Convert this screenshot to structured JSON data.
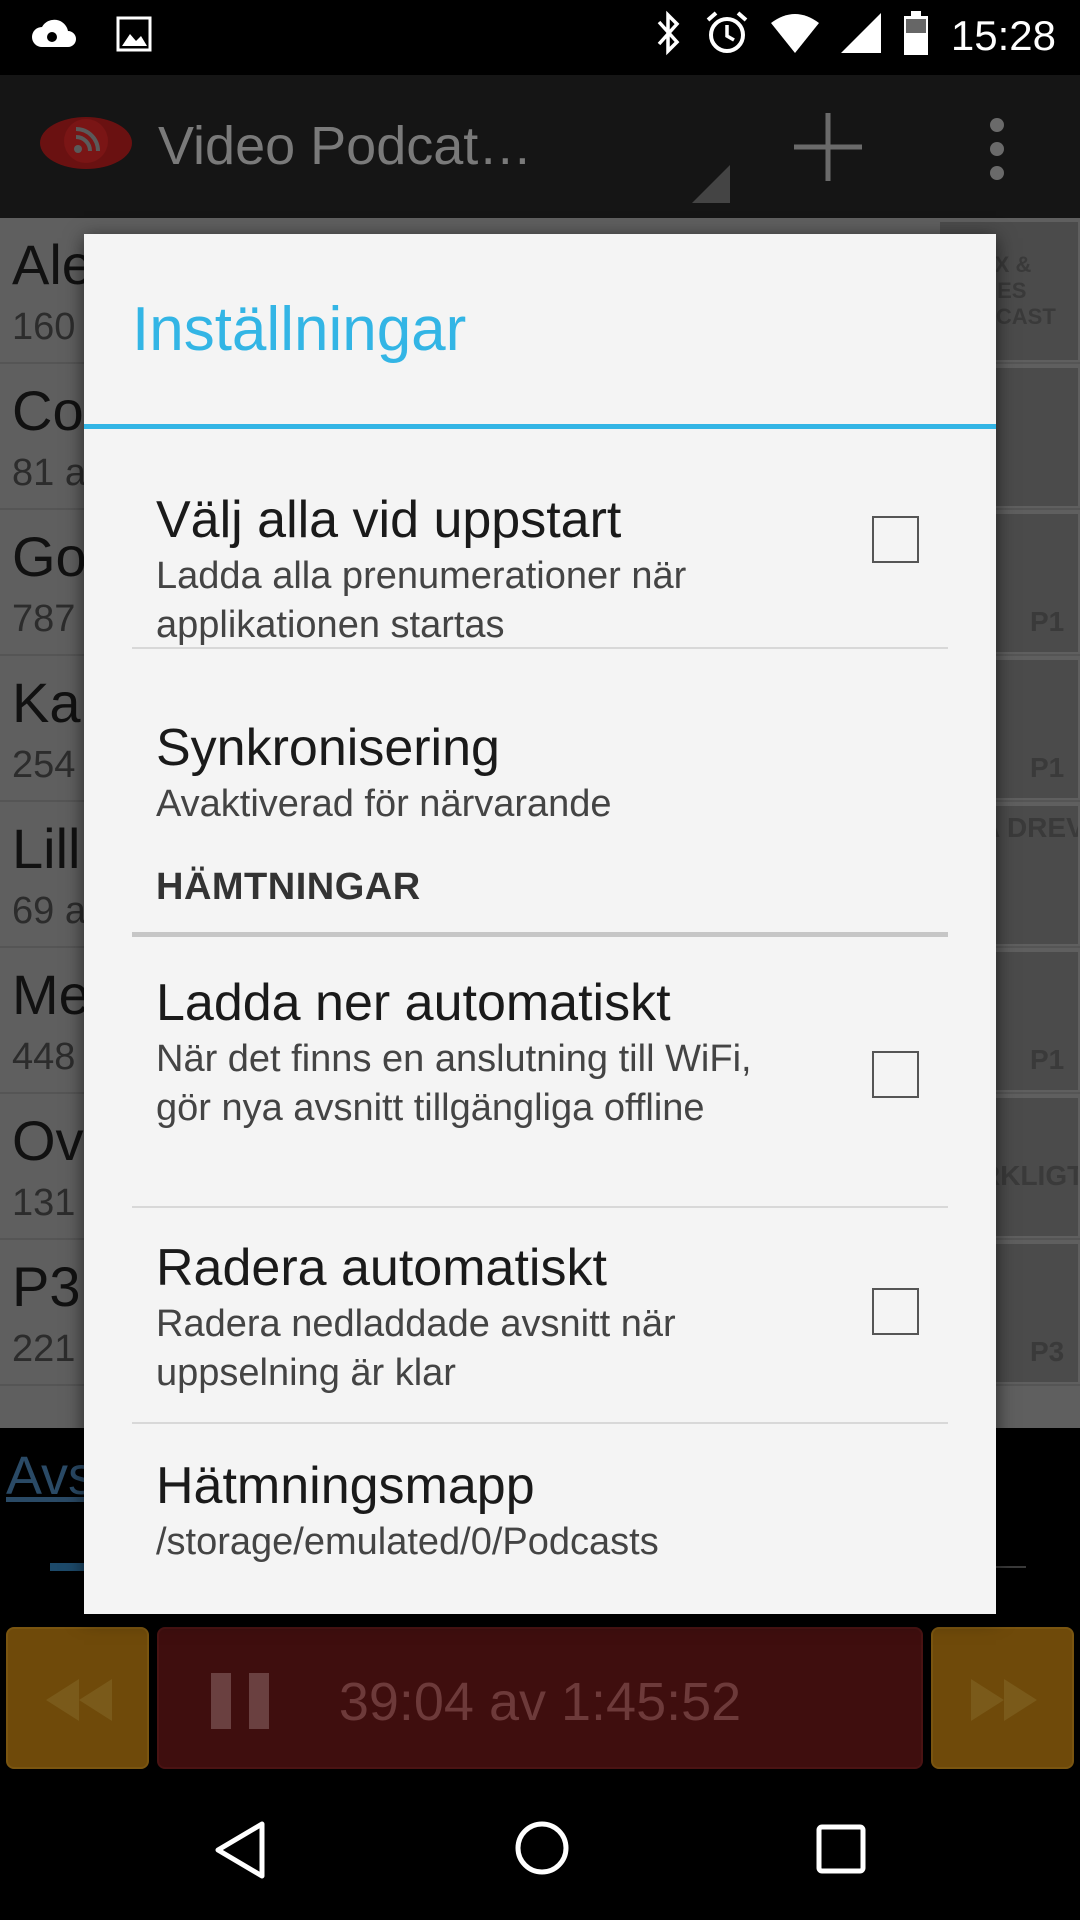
{
  "status_bar": {
    "time": "15:28",
    "left_icons": [
      "cloud-sync-icon",
      "image-icon"
    ],
    "right_icons": [
      "bluetooth-icon",
      "alarm-icon",
      "wifi-icon",
      "signal-icon",
      "battery-icon"
    ]
  },
  "app_bar": {
    "title": "Video Podcat…",
    "icons": [
      "app-logo-icon",
      "add-icon",
      "overflow-menu-icon"
    ]
  },
  "background_list": {
    "rows": [
      {
        "title": "Ale",
        "subtitle": "160"
      },
      {
        "title": "Co",
        "subtitle": "81 a"
      },
      {
        "title": "Go",
        "subtitle": "787"
      },
      {
        "title": "Ka",
        "subtitle": "254"
      },
      {
        "title": "Lill",
        "subtitle": "69 a"
      },
      {
        "title": "Me",
        "subtitle": "448"
      },
      {
        "title": "Ov",
        "subtitle": "131"
      },
      {
        "title": "P3",
        "subtitle": "221"
      }
    ],
    "thumb_labels": [
      "EX & GES DCAST",
      "",
      "P1",
      "P1",
      "A DREVET",
      "P1",
      "RKLIGT",
      "P3"
    ],
    "link_text": "Avs"
  },
  "player": {
    "time_text": "39:04 av 1:45:52",
    "icons": [
      "rewind-icon",
      "pause-icon",
      "fast-forward-icon"
    ]
  },
  "dialog": {
    "title": "Inställningar",
    "title_color": "#33b5e5",
    "prefs": [
      {
        "title": "Välj alla vid uppstart",
        "summary": "Ladda alla prenumerationer när applikationen startas",
        "checked": false
      },
      {
        "title": "Synkronisering",
        "summary": "Avaktiverad för närvarande"
      }
    ],
    "section_header": "HÄMTNINGAR",
    "download_prefs": [
      {
        "title": "Ladda ner automatiskt",
        "summary": "När det finns en anslutning till WiFi, gör nya avsnitt tillgängliga offline",
        "checked": false
      },
      {
        "title": "Radera automatiskt",
        "summary": "Radera nedladdade avsnitt när uppselning är klar",
        "checked": false
      },
      {
        "title": "Hätmningsmapp",
        "summary": "/storage/emulated/0/Podcasts"
      }
    ]
  },
  "nav_bar": {
    "icons": [
      "back-icon",
      "home-icon",
      "recents-icon"
    ]
  }
}
